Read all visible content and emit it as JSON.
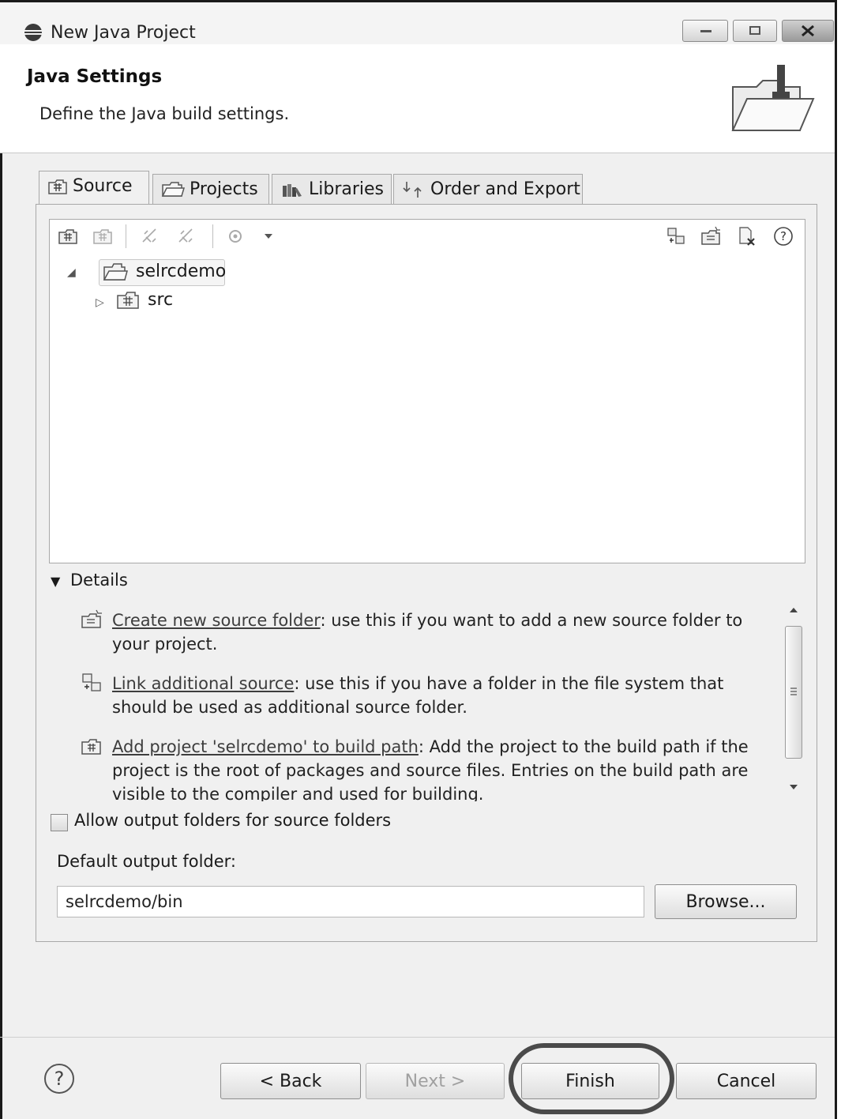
{
  "window": {
    "title": "New Java Project",
    "icon": "eclipse-icon"
  },
  "header": {
    "title": "Java Settings",
    "description": "Define the Java build settings.",
    "icon": "folder-wizard-icon"
  },
  "tabs": [
    {
      "label": "Source",
      "icon": "source-folder-icon",
      "active": true
    },
    {
      "label": "Projects",
      "icon": "projects-folder-icon",
      "active": false
    },
    {
      "label": "Libraries",
      "icon": "libraries-icon",
      "active": false
    },
    {
      "label": "Order and Export",
      "icon": "order-export-icon",
      "active": false
    }
  ],
  "tree": {
    "project": "selrcdemo",
    "children": [
      "src"
    ]
  },
  "details": {
    "label": "Details",
    "entries": [
      {
        "link": "Create new source folder",
        "text1": ": use this if you want to add a new source folder to",
        "text2": "your project.",
        "icon": "new-source-folder-icon"
      },
      {
        "link": "Link additional source",
        "text1": ": use this if you have a folder in the file system that",
        "text2": "should be used as additional source folder.",
        "icon": "link-source-icon"
      },
      {
        "link": "Add project 'selrcdemo' to build path",
        "text1": ": Add the project to the build path if the",
        "text2": "project is the root of packages and source files. Entries on the build path are",
        "text3": "visible to the compiler and used for building.",
        "icon": "add-build-path-icon"
      }
    ]
  },
  "allow_output": {
    "label": "Allow output folders for source folders",
    "checked": false
  },
  "output": {
    "label": "Default output folder:",
    "value": "selrcdemo/bin",
    "browse": "Browse..."
  },
  "buttons": {
    "back": "< Back",
    "next": "Next >",
    "finish": "Finish",
    "cancel": "Cancel"
  },
  "help_glyph": "?"
}
